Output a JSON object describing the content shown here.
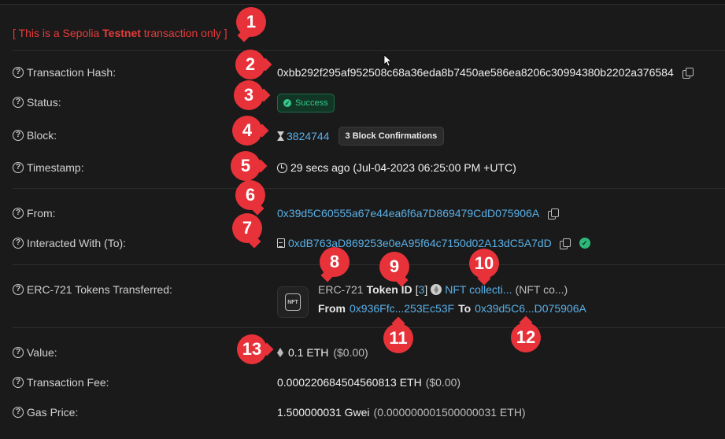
{
  "notice": {
    "prefix": "[ This is a Sepolia ",
    "bold": "Testnet",
    "suffix": " transaction only ]"
  },
  "labels": {
    "hash": "Transaction Hash:",
    "status": "Status:",
    "block": "Block:",
    "timestamp": "Timestamp:",
    "from": "From:",
    "to": "Interacted With (To):",
    "erc721": "ERC-721 Tokens Transferred:",
    "value": "Value:",
    "fee": "Transaction Fee:",
    "gas": "Gas Price:"
  },
  "values": {
    "hash": "0xbb292f295af952508c68a36eda8b7450ae586ea8206c30994380b2202a376584",
    "status": "Success",
    "block": "3824744",
    "confirmations": "3 Block Confirmations",
    "timestamp": "29 secs ago (Jul-04-2023 06:25:00 PM +UTC)",
    "from": "0x39d5C60555a67e44ea6f6a7D869479CdD075906A",
    "to": "0xdB763aD869253e0eA95f64c7150d02A13dC5A7dD",
    "value_amount": "0.1 ETH",
    "value_usd": "($0.00)",
    "fee_amount": "0.000220684504560813 ETH",
    "fee_usd": "($0.00)",
    "gas_amount": "1.500000031 Gwei",
    "gas_eth": "(0.000000001500000031 ETH)"
  },
  "erc721": {
    "standard": "ERC-721",
    "token_id_label": "Token ID",
    "token_id_open": "[",
    "token_id": "3",
    "token_id_close": "]",
    "collection": "NFT collecti...",
    "collection_symbol": "(NFT co...)",
    "from_label": "From",
    "from_addr": "0x936Ffc...253Ec53F",
    "to_label": "To",
    "to_addr": "0x39d5C6...D075906A",
    "nft_icon_text": "NFT"
  },
  "markers": [
    "1",
    "2",
    "3",
    "4",
    "5",
    "6",
    "7",
    "8",
    "9",
    "10",
    "11",
    "12",
    "13"
  ],
  "icons": {
    "help": "question-circle-icon",
    "copy": "copy-icon",
    "success": "check-circle-icon",
    "block": "hourglass-icon",
    "time": "clock-icon",
    "contract": "document-icon",
    "verified": "verified-check-icon",
    "eth": "ethereum-icon"
  },
  "colors": {
    "accent_link": "#5ab0e8",
    "testnet_red": "#e63b3b",
    "success_green": "#35c98a",
    "marker_red": "#e8323a"
  }
}
